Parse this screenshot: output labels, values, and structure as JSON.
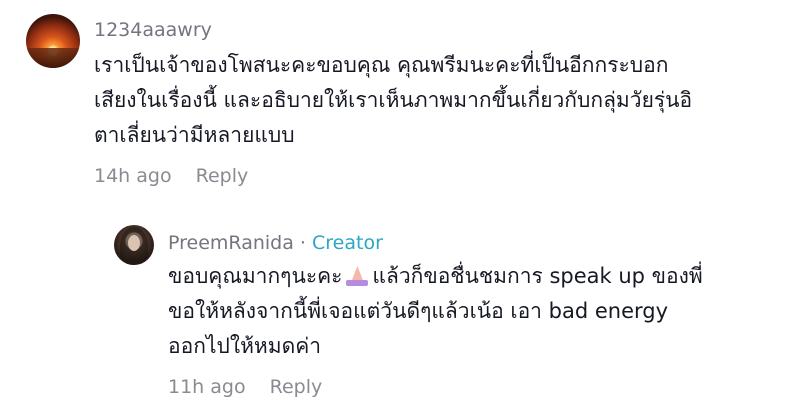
{
  "comment": {
    "username": "1234aaawry",
    "text_lines": [
      "เราเป็นเจ้าของโพสนะคะขอบคุณ คุณพรีมนะคะที่เป็นอีกกระบอก",
      "เสียงในเรื่องนี้ และอธิบายให้เราเห็นภาพมากขึ้นเกี่ยวกับกลุ่มวัยรุ่นอิ",
      "ตาเลี่ยนว่ามีหลายแบบ"
    ],
    "timestamp": "14h ago",
    "reply_label": "Reply"
  },
  "reply": {
    "username": "PreemRanida",
    "separator": "·",
    "badge": "Creator",
    "text_line1_a": "ขอบคุณมากๆนะคะ",
    "emoji_icon": "praying-hands-icon",
    "text_line1_b": "แล้วก็ขอชื่นชมการ speak up ของพี่",
    "text_line2": "ขอให้หลังจากนี้พี่เจอแต่วันดีๆแล้วเน้อ เอา bad energy",
    "text_line3": "ออกไปให้หมดค่า",
    "timestamp": "11h ago",
    "reply_label": "Reply"
  }
}
